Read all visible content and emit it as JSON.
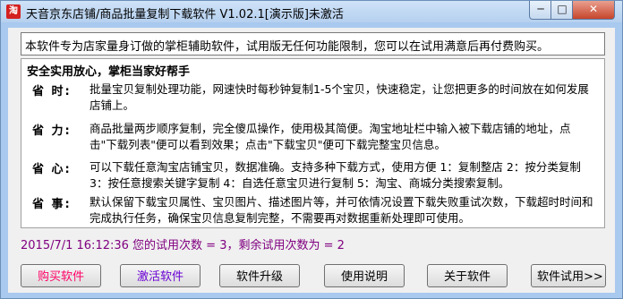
{
  "window": {
    "app_icon_text": "淘",
    "title": "天音京东店铺/商品批量复制下载软件 V1.02.1[演示版]未激活",
    "min_glyph": "─",
    "max_glyph": "□",
    "close_glyph": "✕"
  },
  "intro": "本软件专为店家量身订做的掌柜辅助软件，试用版无任何功能限制，您可以在试用满意后再付费购买。",
  "panel": {
    "heading": "安全实用放心，掌柜当家好帮手",
    "items": [
      {
        "label": "省 时:",
        "text": "批量宝贝复制处理功能，网速快时每秒钟复制1-5个宝贝，快速稳定，让您把更多的时间放在如何发展店铺上。"
      },
      {
        "label": "省 力:",
        "text": "商品批量两步顺序复制，完全傻瓜操作，使用极其简便。淘宝地址栏中输入被下载店铺的地址，点击\"下载列表\"便可以看到效果；点击\"下载宝贝\"便可下载完整宝贝信息。"
      },
      {
        "label": "省 心:",
        "text": "可以下载任意淘宝店铺宝贝，数据准确。支持多种下载方式，使用方便 1：复制整店 2：按分类复制 3：按任意搜索关键字复制 4：自选任意宝贝进行复制 5：淘宝、商城分类搜索复制。"
      },
      {
        "label": "省 事:",
        "text": "默认保留下载宝贝属性、宝贝图片、描述图片等，并可依情况设置下载失败重试次数，下载超时时间和完成执行任务，确保宝贝信息复制完整，不需要再对数据重新处理即可使用。"
      }
    ]
  },
  "status": "2015/7/1 16:12:36  您的试用次数 = 3，剩余试用次数为 = 2",
  "buttons": {
    "buy": "购买软件",
    "activate": "激活软件",
    "upgrade": "软件升级",
    "help": "使用说明",
    "about": "关于软件",
    "trial": "软件试用>>"
  },
  "colors": {
    "buy_text": "#ff0066",
    "activate_text": "#6a00d4",
    "status_text": "#800080",
    "titlebar": "#b5d0ef"
  }
}
